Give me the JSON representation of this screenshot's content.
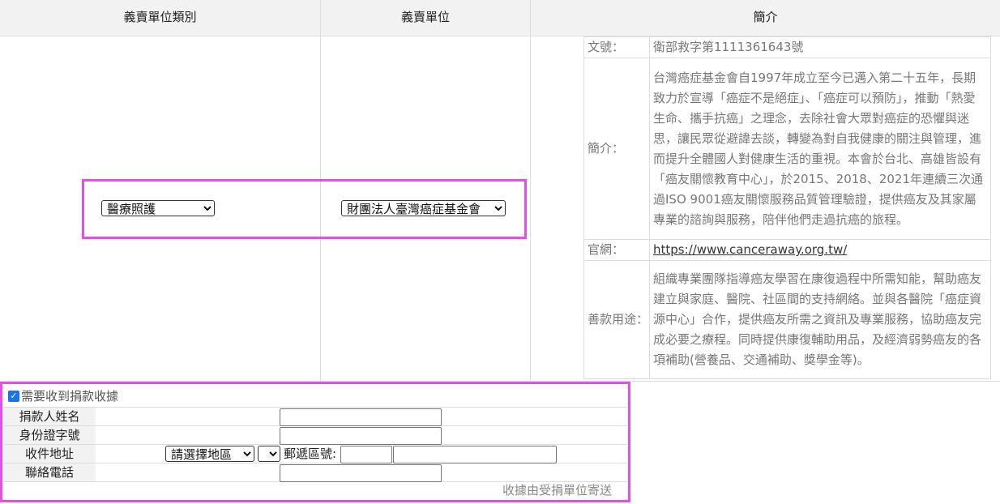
{
  "table_header": {
    "category": "義賣單位類別",
    "unit": "義賣單位",
    "intro": "簡介"
  },
  "selects": {
    "category_value": "醫療照護",
    "unit_value": "財團法人臺灣癌症基金會"
  },
  "intro": {
    "doc_no_label": "文號：",
    "doc_no_value": "衛部救字第1111361643號",
    "summary_label": "簡介：",
    "summary_value": "台灣癌症基金會自1997年成立至今已邁入第二十五年，長期致力於宣導「癌症不是絕症」、「癌症可以預防」，推動「熱愛生命、攜手抗癌」之理念，去除社會大眾對癌症的恐懼與迷思，讓民眾從避諱去談，轉變為對自我健康的關注與管理，進而提升全體國人對健康生活的重視。本會於台北、高雄皆設有「癌友關懷教育中心」，於2015、2018、2021年連續三次通過ISO 9001癌友關懷服務品質管理驗證，提供癌友及其家屬專業的諮詢與服務，陪伴他們走過抗癌的旅程。",
    "website_label": "官網：",
    "website_value": "https://www.canceraway.org.tw/",
    "usage_label": "善款用途：",
    "usage_value": "組織專業團隊指導癌友學習在康復過程中所需知能，幫助癌友建立與家庭、醫院、社區間的支持網絡。並與各醫院「癌症資源中心」合作，提供癌友所需之資訊及專業服務，協助癌友完成必要之療程。同時提供康復輔助用品，及經濟弱勢癌友的各項補助(營養品、交通補助、獎學金等)。"
  },
  "receipt": {
    "checkbox_label": "需要收到捐款收據",
    "checked": true,
    "name_label": "捐款人姓名",
    "name_value": "",
    "id_label": "身份證字號",
    "id_value": "",
    "address_label": "收件地址",
    "region_select_value": "請選擇地區",
    "district_select_value": "",
    "postal_label": "郵遞區號:",
    "postal_value": "",
    "address_value": "",
    "phone_label": "聯絡電話",
    "phone_value": "",
    "note": "收據由受捐單位寄送"
  },
  "colors": {
    "highlight": "#e94ce9",
    "checkbox": "#1a73e8",
    "header_bg": "#f2f2f2"
  }
}
